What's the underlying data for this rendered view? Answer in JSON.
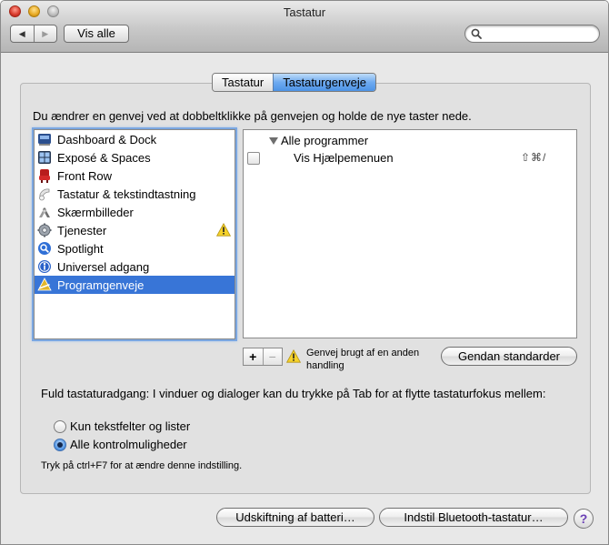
{
  "window": {
    "title": "Tastatur"
  },
  "toolbar": {
    "back_glyph": "◀",
    "forward_glyph": "▶",
    "show_all_label": "Vis alle",
    "search": {
      "value": "",
      "placeholder": ""
    }
  },
  "tabs": [
    {
      "label": "Tastatur",
      "selected": false
    },
    {
      "label": "Tastaturgenveje",
      "selected": true
    }
  ],
  "instruction": "Du ændrer en genvej ved at dobbeltklikke på genvejen og holde de nye taster nede.",
  "categories": [
    {
      "label": "Dashboard & Dock",
      "icon": "dashboard-icon"
    },
    {
      "label": "Exposé & Spaces",
      "icon": "expose-icon"
    },
    {
      "label": "Front Row",
      "icon": "front-row-icon"
    },
    {
      "label": "Tastatur & tekstindtastning",
      "icon": "keyboard-icon"
    },
    {
      "label": "Skærmbilleder",
      "icon": "screenshot-icon"
    },
    {
      "label": "Tjenester",
      "icon": "gear-icon",
      "warning": true
    },
    {
      "label": "Spotlight",
      "icon": "spotlight-icon"
    },
    {
      "label": "Universel adgang",
      "icon": "accessibility-icon"
    },
    {
      "label": "Programgenveje",
      "icon": "app-shortcuts-icon",
      "selected": true
    }
  ],
  "shortcuts": {
    "group": "Alle programmer",
    "items": [
      {
        "name": "Vis Hjælpemenuen",
        "keys": "⇧⌘/",
        "checked": false
      }
    ]
  },
  "add_label": "+",
  "remove_label": "−",
  "conflict_warning": "Genvej brugt af en anden handling",
  "restore_defaults_label": "Gendan standarder",
  "full_access": {
    "text": "Fuld tastaturadgang: I vinduer og dialoger kan du trykke på Tab for at flytte tastaturfokus mellem:",
    "options": [
      {
        "label": "Kun tekstfelter og lister",
        "selected": false
      },
      {
        "label": "Alle kontrolmuligheder",
        "selected": true
      }
    ],
    "hint": "Tryk på ctrl+F7 for at ændre denne indstilling."
  },
  "footer": {
    "battery_label": "Udskiftning af batteri…",
    "bluetooth_label": "Indstil Bluetooth-tastatur…",
    "help_label": "?"
  },
  "colors": {
    "selection": "#3875d7",
    "tab_selected": "#6eaaf0",
    "warning": "#f5d22a"
  }
}
